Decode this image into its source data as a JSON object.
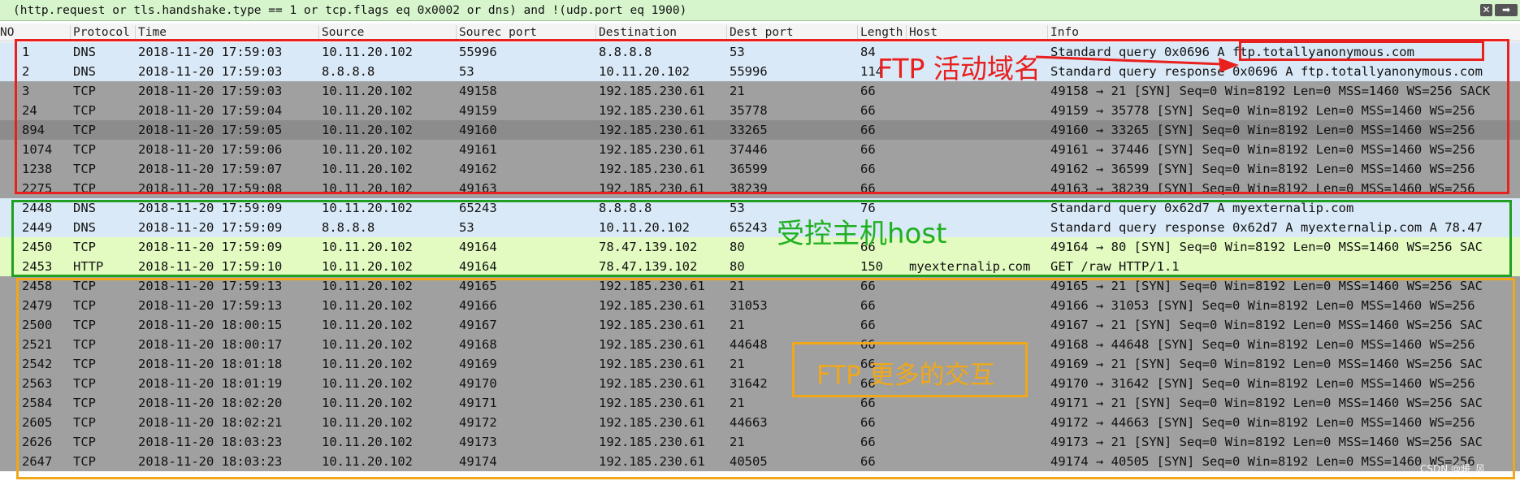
{
  "filter": {
    "value": "(http.request or tls.handshake.type == 1 or tcp.flags eq 0x0002 or dns) and !(udp.port eq 1900)",
    "clear_icon": "close-icon",
    "apply_icon": "arrow-right-icon",
    "clear_glyph": "✕",
    "apply_glyph": "➡"
  },
  "columns": [
    "NO",
    "Protocol",
    "Time",
    "Source",
    "Sourec port",
    "Destination",
    "Dest port",
    "Length",
    "Host",
    "Info"
  ],
  "packets": [
    {
      "no": "1",
      "proto": "DNS",
      "time": "2018-11-20 17:59:03",
      "src": "10.11.20.102",
      "sport": "55996",
      "dst": "8.8.8.8",
      "dport": "53",
      "len": "84",
      "host": "",
      "info": "Standard query 0x0696 A ftp.totallyanonymous.com",
      "color": "dns"
    },
    {
      "no": "2",
      "proto": "DNS",
      "time": "2018-11-20 17:59:03",
      "src": "8.8.8.8",
      "sport": "53",
      "dst": "10.11.20.102",
      "dport": "55996",
      "len": "114",
      "host": "",
      "info": "Standard query response 0x0696 A ftp.totallyanonymous.com",
      "color": "dns"
    },
    {
      "no": "3",
      "proto": "TCP",
      "time": "2018-11-20 17:59:03",
      "src": "10.11.20.102",
      "sport": "49158",
      "dst": "192.185.230.61",
      "dport": "21",
      "len": "66",
      "host": "",
      "info": "49158 → 21 [SYN] Seq=0 Win=8192 Len=0 MSS=1460 WS=256 SACK",
      "color": "tcp"
    },
    {
      "no": "24",
      "proto": "TCP",
      "time": "2018-11-20 17:59:04",
      "src": "10.11.20.102",
      "sport": "49159",
      "dst": "192.185.230.61",
      "dport": "35778",
      "len": "66",
      "host": "",
      "info": "49159 → 35778 [SYN] Seq=0 Win=8192 Len=0 MSS=1460 WS=256",
      "color": "tcp"
    },
    {
      "no": "894",
      "proto": "TCP",
      "time": "2018-11-20 17:59:05",
      "src": "10.11.20.102",
      "sport": "49160",
      "dst": "192.185.230.61",
      "dport": "33265",
      "len": "66",
      "host": "",
      "info": "49160 → 33265 [SYN] Seq=0 Win=8192 Len=0 MSS=1460 WS=256",
      "color": "sel"
    },
    {
      "no": "1074",
      "proto": "TCP",
      "time": "2018-11-20 17:59:06",
      "src": "10.11.20.102",
      "sport": "49161",
      "dst": "192.185.230.61",
      "dport": "37446",
      "len": "66",
      "host": "",
      "info": "49161 → 37446 [SYN] Seq=0 Win=8192 Len=0 MSS=1460 WS=256",
      "color": "tcp"
    },
    {
      "no": "1238",
      "proto": "TCP",
      "time": "2018-11-20 17:59:07",
      "src": "10.11.20.102",
      "sport": "49162",
      "dst": "192.185.230.61",
      "dport": "36599",
      "len": "66",
      "host": "",
      "info": "49162 → 36599 [SYN] Seq=0 Win=8192 Len=0 MSS=1460 WS=256",
      "color": "tcp"
    },
    {
      "no": "2275",
      "proto": "TCP",
      "time": "2018-11-20 17:59:08",
      "src": "10.11.20.102",
      "sport": "49163",
      "dst": "192.185.230.61",
      "dport": "38239",
      "len": "66",
      "host": "",
      "info": "49163 → 38239 [SYN] Seq=0 Win=8192 Len=0 MSS=1460 WS=256",
      "color": "tcp"
    },
    {
      "no": "2448",
      "proto": "DNS",
      "time": "2018-11-20 17:59:09",
      "src": "10.11.20.102",
      "sport": "65243",
      "dst": "8.8.8.8",
      "dport": "53",
      "len": "76",
      "host": "",
      "info": "Standard query 0x62d7 A myexternalip.com",
      "color": "dns"
    },
    {
      "no": "2449",
      "proto": "DNS",
      "time": "2018-11-20 17:59:09",
      "src": "8.8.8.8",
      "sport": "53",
      "dst": "10.11.20.102",
      "dport": "65243",
      "len": "",
      "host": "",
      "info": "Standard query response 0x62d7 A myexternalip.com A 78.47",
      "color": "dns"
    },
    {
      "no": "2450",
      "proto": "TCP",
      "time": "2018-11-20 17:59:09",
      "src": "10.11.20.102",
      "sport": "49164",
      "dst": "78.47.139.102",
      "dport": "80",
      "len": "66",
      "host": "",
      "info": "49164 → 80 [SYN] Seq=0 Win=8192 Len=0 MSS=1460 WS=256 SAC",
      "color": "http"
    },
    {
      "no": "2453",
      "proto": "HTTP",
      "time": "2018-11-20 17:59:10",
      "src": "10.11.20.102",
      "sport": "49164",
      "dst": "78.47.139.102",
      "dport": "80",
      "len": "150",
      "host": "myexternalip.com",
      "info": "GET /raw HTTP/1.1",
      "color": "http"
    },
    {
      "no": "2458",
      "proto": "TCP",
      "time": "2018-11-20 17:59:13",
      "src": "10.11.20.102",
      "sport": "49165",
      "dst": "192.185.230.61",
      "dport": "21",
      "len": "66",
      "host": "",
      "info": "49165 → 21 [SYN] Seq=0 Win=8192 Len=0 MSS=1460 WS=256 SAC",
      "color": "tcp"
    },
    {
      "no": "2479",
      "proto": "TCP",
      "time": "2018-11-20 17:59:13",
      "src": "10.11.20.102",
      "sport": "49166",
      "dst": "192.185.230.61",
      "dport": "31053",
      "len": "66",
      "host": "",
      "info": "49166 → 31053 [SYN] Seq=0 Win=8192 Len=0 MSS=1460 WS=256",
      "color": "tcp"
    },
    {
      "no": "2500",
      "proto": "TCP",
      "time": "2018-11-20 18:00:15",
      "src": "10.11.20.102",
      "sport": "49167",
      "dst": "192.185.230.61",
      "dport": "21",
      "len": "66",
      "host": "",
      "info": "49167 → 21 [SYN] Seq=0 Win=8192 Len=0 MSS=1460 WS=256 SAC",
      "color": "tcp"
    },
    {
      "no": "2521",
      "proto": "TCP",
      "time": "2018-11-20 18:00:17",
      "src": "10.11.20.102",
      "sport": "49168",
      "dst": "192.185.230.61",
      "dport": "44648",
      "len": "66",
      "host": "",
      "info": "49168 → 44648 [SYN] Seq=0 Win=8192 Len=0 MSS=1460 WS=256",
      "color": "tcp"
    },
    {
      "no": "2542",
      "proto": "TCP",
      "time": "2018-11-20 18:01:18",
      "src": "10.11.20.102",
      "sport": "49169",
      "dst": "192.185.230.61",
      "dport": "21",
      "len": "66",
      "host": "",
      "info": "49169 → 21 [SYN] Seq=0 Win=8192 Len=0 MSS=1460 WS=256 SAC",
      "color": "tcp"
    },
    {
      "no": "2563",
      "proto": "TCP",
      "time": "2018-11-20 18:01:19",
      "src": "10.11.20.102",
      "sport": "49170",
      "dst": "192.185.230.61",
      "dport": "31642",
      "len": "66",
      "host": "",
      "info": "49170 → 31642 [SYN] Seq=0 Win=8192 Len=0 MSS=1460 WS=256",
      "color": "tcp"
    },
    {
      "no": "2584",
      "proto": "TCP",
      "time": "2018-11-20 18:02:20",
      "src": "10.11.20.102",
      "sport": "49171",
      "dst": "192.185.230.61",
      "dport": "21",
      "len": "66",
      "host": "",
      "info": "49171 → 21 [SYN] Seq=0 Win=8192 Len=0 MSS=1460 WS=256 SAC",
      "color": "tcp"
    },
    {
      "no": "2605",
      "proto": "TCP",
      "time": "2018-11-20 18:02:21",
      "src": "10.11.20.102",
      "sport": "49172",
      "dst": "192.185.230.61",
      "dport": "44663",
      "len": "66",
      "host": "",
      "info": "49172 → 44663 [SYN] Seq=0 Win=8192 Len=0 MSS=1460 WS=256",
      "color": "tcp"
    },
    {
      "no": "2626",
      "proto": "TCP",
      "time": "2018-11-20 18:03:23",
      "src": "10.11.20.102",
      "sport": "49173",
      "dst": "192.185.230.61",
      "dport": "21",
      "len": "66",
      "host": "",
      "info": "49173 → 21 [SYN] Seq=0 Win=8192 Len=0 MSS=1460 WS=256 SAC",
      "color": "tcp"
    },
    {
      "no": "2647",
      "proto": "TCP",
      "time": "2018-11-20 18:03:23",
      "src": "10.11.20.102",
      "sport": "49174",
      "dst": "192.185.230.61",
      "dport": "40505",
      "len": "66",
      "host": "",
      "info": "49174 → 40505 [SYN] Seq=0 Win=8192 Len=0 MSS=1460 WS=256",
      "color": "tcp"
    }
  ],
  "annotations": {
    "ftp_domain": "FTP 活动域名",
    "controlled_host": "受控主机host",
    "ftp_more": "FTP 更多的交互",
    "ftp_color": "#e8201e",
    "host_color": "#20b020",
    "more_color": "#f0a818"
  },
  "watermark": "CSDN @暖_风"
}
